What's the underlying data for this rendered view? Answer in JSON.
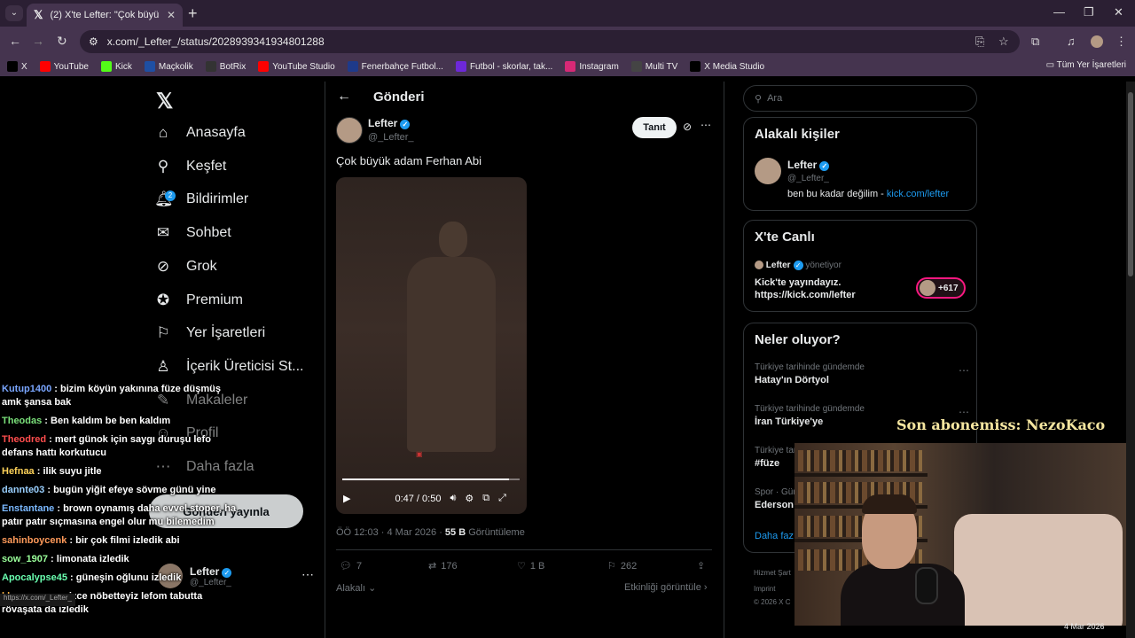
{
  "browser": {
    "tab_title": "(2) X'te Lefter: \"Çok büyük adam",
    "url": "x.com/_Lefter_/status/2028939341934801288",
    "bookmarks": [
      {
        "label": "X",
        "color": "#000000"
      },
      {
        "label": "YouTube",
        "color": "#ff0000"
      },
      {
        "label": "Kick",
        "color": "#53fc18"
      },
      {
        "label": "Maçkolik",
        "color": "#1e4fa3"
      },
      {
        "label": "BotRix",
        "color": "#333333"
      },
      {
        "label": "YouTube Studio",
        "color": "#ff0000"
      },
      {
        "label": "Fenerbahçe Futbol...",
        "color": "#1e3a8a"
      },
      {
        "label": "Futbol - skorlar, tak...",
        "color": "#6d28d9"
      },
      {
        "label": "Instagram",
        "color": "#d62976"
      },
      {
        "label": "Multi TV",
        "color": "#444444"
      },
      {
        "label": "X Media Studio",
        "color": "#000000"
      }
    ],
    "all_bookmarks": "Tüm Yer İşaretleri"
  },
  "sidebar": {
    "items": [
      {
        "label": "Anasayfa",
        "icon": "home-icon",
        "glyph": "⌂"
      },
      {
        "label": "Keşfet",
        "icon": "search-icon",
        "glyph": "⚲"
      },
      {
        "label": "Bildirimler",
        "icon": "bell-icon",
        "glyph": "🔔︎"
      },
      {
        "label": "Sohbet",
        "icon": "mail-icon",
        "glyph": "✉"
      },
      {
        "label": "Grok",
        "icon": "grok-icon",
        "glyph": "⊘"
      },
      {
        "label": "Premium",
        "icon": "premium-icon",
        "glyph": "✪"
      },
      {
        "label": "Yer İşaretleri",
        "icon": "bookmark-icon",
        "glyph": "⚐"
      },
      {
        "label": "İçerik Üreticisi St...",
        "icon": "creator-icon",
        "glyph": "♙"
      },
      {
        "label": "Makaleler",
        "icon": "articles-icon",
        "glyph": "✎"
      },
      {
        "label": "Profil",
        "icon": "profile-icon",
        "glyph": "☺"
      },
      {
        "label": "Daha fazla",
        "icon": "more-icon",
        "glyph": "⋯"
      }
    ],
    "notification_count": "2",
    "post_button": "Gönderi yayınla",
    "account_name": "Lefter",
    "account_handle": "@_Lefter_"
  },
  "post": {
    "header_title": "Gönderi",
    "author": "Lefter",
    "handle": "@_Lefter_",
    "follow_label": "Tanıt",
    "text": "Çok büyük adam Ferhan Abi",
    "video_time": "0:47 / 0:50",
    "video_progress": 0.94,
    "time": "ÖÖ 12:03",
    "date": "4 Mar 2026",
    "views": "55 B",
    "views_label": "Görüntüleme",
    "replies": "7",
    "reposts": "176",
    "likes": "1 B",
    "bookmarks": "262",
    "relevant": "Alakalı",
    "activity": "Etkinliği görüntüle"
  },
  "right": {
    "search_placeholder": "Ara",
    "relevant_title": "Alakalı kişiler",
    "rel_name": "Lefter",
    "rel_handle": "@_Lefter_",
    "rel_bio_text": "ben bu kadar değilim - ",
    "rel_bio_link": "kick.com/lefter",
    "live_title": "X'te Canlı",
    "live_host": "Lefter",
    "live_role": "yönetiyor",
    "live_text_1": "Kick'te yayındayız.",
    "live_text_2": "https://kick.com/lefter",
    "live_count": "+617",
    "trends_title": "Neler oluyor?",
    "trends": [
      {
        "category": "Türkiye tarihinde gündemde",
        "name": "Hatay'ın Dörtyol"
      },
      {
        "category": "Türkiye tarihinde gündemde",
        "name": "İran Türkiye'ye"
      },
      {
        "category": "Türkiye tari",
        "name": "#füze"
      },
      {
        "category": "Spor · Gün",
        "name": "Ederson"
      }
    ],
    "show_more": "Daha faz",
    "footer_1": "Hizmet Şart",
    "footer_2": "Imprint",
    "footer_3": "© 2026 X C"
  },
  "overlay": {
    "chat": [
      {
        "user": "Kutup1400",
        "color": "#7aa6ff",
        "msg": "bizim köyün yakınına füze düşmüş amk şansa bak"
      },
      {
        "user": "Theodas",
        "color": "#7ae07a",
        "msg": "Ben kaldım be ben kaldım"
      },
      {
        "user": "Theodred",
        "color": "#ff4d4d",
        "msg": "mert günok için saygı duruşu lefo defans hattı korkutucu"
      },
      {
        "user": "Hefnaa",
        "color": "#ffd35a",
        "msg": "ilik suyu jitle"
      },
      {
        "user": "dannte03",
        "color": "#9ad0ff",
        "msg": "bugün yiğit efeye sövme günü yine"
      },
      {
        "user": "Enstantane",
        "color": "#7ab8ff",
        "msg": "brown oynamış daha evvel stoper, ha patır patır sıçmasına engel olur mu bilemedim"
      },
      {
        "user": "sahinboycenk",
        "color": "#ff9a5a",
        "msg": "bir çok filmi izledik abi"
      },
      {
        "user": "sow_1907",
        "color": "#9aff9a",
        "msg": "limonata izledik"
      },
      {
        "user": "Apocalypse45",
        "color": "#6affb0",
        "msg": "güneşin oğlunu izledik"
      },
      {
        "user": "khanma",
        "color": "#ffb347",
        "msg": "sessizce nöbetteyiz lefom tabutta rövaşata da izledik"
      }
    ],
    "sub_banner": "Son abonemiss: NezoKaco",
    "taskbar_date": "4 Mar 2026",
    "url_preview": "https://x.com/_Lefter_"
  }
}
